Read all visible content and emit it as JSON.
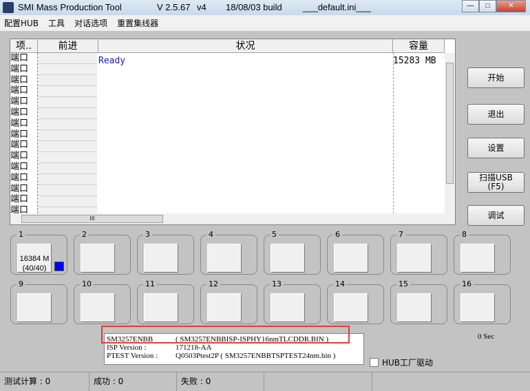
{
  "title": {
    "app": "SMI Mass Production Tool",
    "version": "V 2.5.67",
    "variant": "v4",
    "build": "18/08/03 build",
    "ini": "___default.ini___",
    "min": "—",
    "max": "□",
    "close": "✕"
  },
  "menu": [
    "配置HUB",
    "工具",
    "对话选项",
    "重置集线器"
  ],
  "list": {
    "headers": [
      "项..",
      "前进",
      "状况",
      "容量"
    ],
    "port_label": "端口",
    "rows": 15,
    "status": "Ready",
    "capacity": "15283 MB",
    "hthumb": "III"
  },
  "buttons": {
    "start": "开始",
    "exit": "退出",
    "settings": "设置",
    "scan": "扫描USB\n(F5)",
    "debug": "调试"
  },
  "ports": [
    {
      "n": "1",
      "text": "16384 M\n(40/40)",
      "led": "#0000f0"
    },
    {
      "n": "2"
    },
    {
      "n": "3"
    },
    {
      "n": "4"
    },
    {
      "n": "5"
    },
    {
      "n": "6"
    },
    {
      "n": "7"
    },
    {
      "n": "8"
    },
    {
      "n": "9"
    },
    {
      "n": "10"
    },
    {
      "n": "11"
    },
    {
      "n": "12"
    },
    {
      "n": "13"
    },
    {
      "n": "14"
    },
    {
      "n": "15"
    },
    {
      "n": "16"
    }
  ],
  "info": [
    [
      "SM3257ENBB",
      "( SM3257ENBBISP-ISPHY16nmTLCDDR.BIN )"
    ],
    [
      "ISP Version :",
      "171218-AA"
    ],
    [
      "PTEST Version :",
      "Q0503Ptest2P ( SM3257ENBBTSPTEST24nm.bin )"
    ]
  ],
  "elapsed": "0 Sec",
  "hub_driver": "HUB工厂驱动",
  "statusbar": [
    "测试计算 : 0",
    "成功 : 0",
    "失败 : 0",
    "",
    ""
  ]
}
